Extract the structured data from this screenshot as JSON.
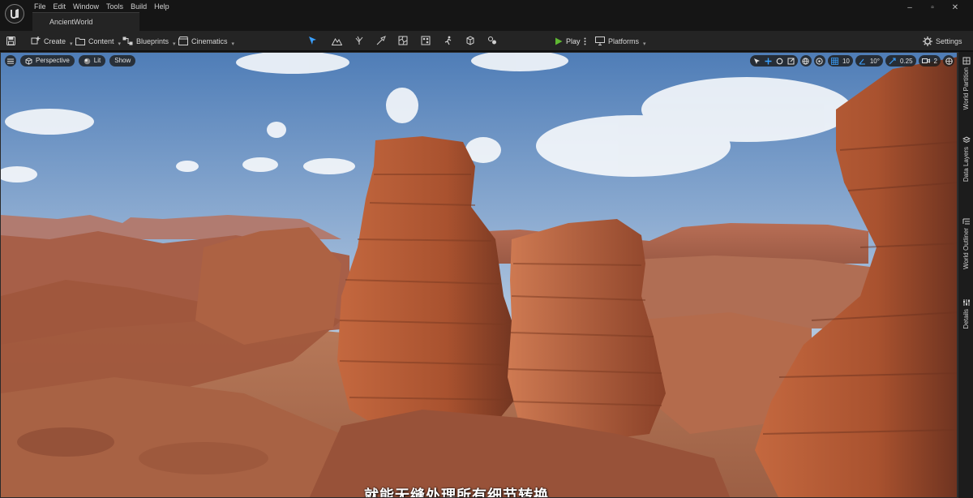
{
  "app": {
    "logo_icon": "unreal-engine-logo-icon",
    "menu": [
      "File",
      "Edit",
      "Window",
      "Tools",
      "Build",
      "Help"
    ],
    "document_tab": "AncientWorld",
    "window_controls": [
      "–",
      "▫",
      "✕"
    ]
  },
  "toolbar": {
    "save_icon": "save-icon",
    "create_label": "Create",
    "content_label": "Content",
    "blueprints_label": "Blueprints",
    "cinematics_label": "Cinematics",
    "modes": [
      "select-mode-icon",
      "landscape-mode-icon",
      "foliage-mode-icon",
      "mesh-paint-mode-icon",
      "fracture-mode-icon",
      "animation-mode-icon",
      "modeling-mode-icon",
      "geometry-mode-icon"
    ],
    "play_label": "Play",
    "platforms_label": "Platforms",
    "settings_label": "Settings",
    "accent_color": "#5fb832"
  },
  "viewport": {
    "perspective_label": "Perspective",
    "lit_label": "Lit",
    "show_label": "Show",
    "grid_snap_value": "10",
    "rotation_snap_value": "10°",
    "scale_snap_value": "0.25",
    "camera_speed_value": "2",
    "subtitle": "就能无缝处理所有细节转换"
  },
  "side_panel": {
    "tabs": [
      "World Partition",
      "Data Layers",
      "World Outliner",
      "Details"
    ]
  }
}
